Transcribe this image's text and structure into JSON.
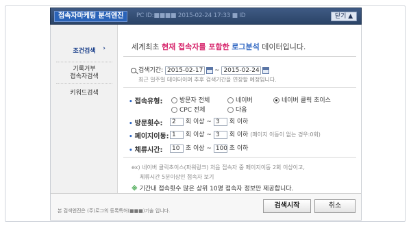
{
  "window": {
    "title": "접속자마케팅 분석엔진",
    "info_text": "PC ID:■■■■ 2015-02-24 17:33 ■ ID",
    "close_label": "닫기 ▲"
  },
  "sidebar": {
    "items": [
      {
        "label": "조건검색",
        "arrow": "›"
      },
      {
        "label_line1": "기록거부",
        "label_line2": "접속자검색"
      },
      {
        "label": "키워드검색"
      }
    ]
  },
  "headline": {
    "part1": "세계최초 ",
    "part2": "현재 접속자를 포함한",
    "part3": " ",
    "part4": "로그분석",
    "part5": " 데이터입니다."
  },
  "search_period": {
    "label": "검색기간:",
    "start": "2015-02-17",
    "sep": "~",
    "end": "2015-02-24",
    "note": "최근 일주일 데이터이며 추후 검색기간을 연장할 예정입니다."
  },
  "visit_type": {
    "label": "접속유형:",
    "options": [
      {
        "label": "방문자 전체",
        "checked": false
      },
      {
        "label": "네이버",
        "checked": false
      },
      {
        "label": "네이버 클릭 초이스",
        "checked": true
      },
      {
        "label": "CPC 전체",
        "checked": false
      },
      {
        "label": "다음",
        "checked": false
      }
    ]
  },
  "visit_count": {
    "label": "방문횟수:",
    "min": "2",
    "mid": "회 이상 ~",
    "max": "3",
    "end": "회 이하"
  },
  "page_moves": {
    "label": "페이지이동:",
    "min": "1",
    "mid": "회 이상 ~",
    "max": "3",
    "end": "회 이하",
    "note": "(페이지 이동이 없는 경우:0회)"
  },
  "stay_time": {
    "label": "체류시간:",
    "min": "10",
    "mid": "초 이상 ~",
    "max": "100",
    "end": "초 이하"
  },
  "example": {
    "line1": "ex) 네이버 클릭초이스(파워링크) 처음 접속자 중 페이지이동 2회 이상이고,",
    "line2": "체류시간 5분이상인 접속자 보기"
  },
  "notice": {
    "mark": "※",
    "text": "기간내 접속횟수 많은 상위 10명 접속자 정보만 제공합니다."
  },
  "footer": {
    "note": "본 검색엔진은 (주)로그의 등록특허(■■■)기술 입니다.",
    "search_label": "검색시작",
    "cancel_label": "취소"
  },
  "colors": {
    "titlebar": "#2b4467",
    "highlight_red": "#d6246b",
    "highlight_blue": "#2f66c2",
    "sidebar_active": "#1a3f8a"
  }
}
